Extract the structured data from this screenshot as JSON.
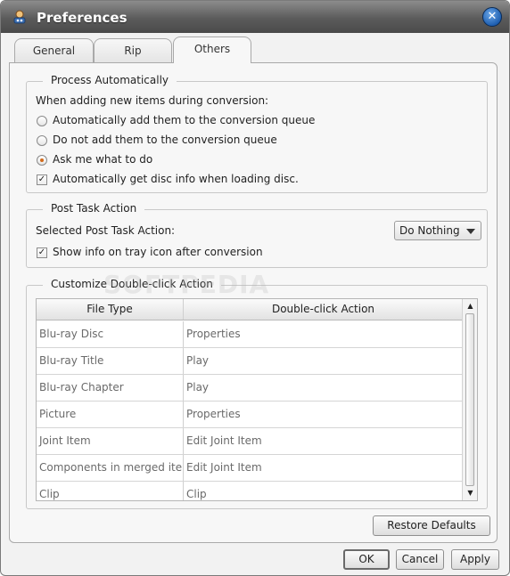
{
  "window": {
    "title": "Preferences"
  },
  "tabs": [
    {
      "label": "General"
    },
    {
      "label": "Rip"
    },
    {
      "label": "Others"
    }
  ],
  "process_automatically": {
    "title": "Process Automatically",
    "prompt": "When adding new items during conversion:",
    "options": [
      {
        "label": "Automatically add them to the conversion queue",
        "selected": false
      },
      {
        "label": "Do not add them to the conversion queue",
        "selected": false
      },
      {
        "label": "Ask me what to do",
        "selected": true
      }
    ],
    "disc_info": {
      "label": "Automatically get disc info when loading disc.",
      "checked": true
    }
  },
  "post_task": {
    "title": "Post Task Action",
    "selected_label": "Selected Post Task Action:",
    "selected_value": "Do Nothing",
    "tray_info": {
      "label": "Show info on tray icon after conversion",
      "checked": true
    }
  },
  "double_click": {
    "title": "Customize Double-click Action",
    "columns": [
      "File Type",
      "Double-click Action"
    ],
    "rows": [
      [
        "Blu-ray Disc",
        "Properties"
      ],
      [
        "Blu-ray Title",
        "Play"
      ],
      [
        "Blu-ray Chapter",
        "Play"
      ],
      [
        "Picture",
        "Properties"
      ],
      [
        "Joint Item",
        "Edit Joint Item"
      ],
      [
        "Components in merged items",
        "Edit Joint Item"
      ],
      [
        "Clip",
        "Clip"
      ]
    ]
  },
  "buttons": {
    "restore_defaults": "Restore Defaults",
    "ok": "OK",
    "cancel": "Cancel",
    "apply": "Apply"
  },
  "icons": {
    "app": "app-icon",
    "close": "close-icon"
  },
  "colors": {
    "titlebar": "#5b5b5b",
    "radio_selected": "#d26b1c"
  },
  "watermark": "SOFTPEDIA"
}
